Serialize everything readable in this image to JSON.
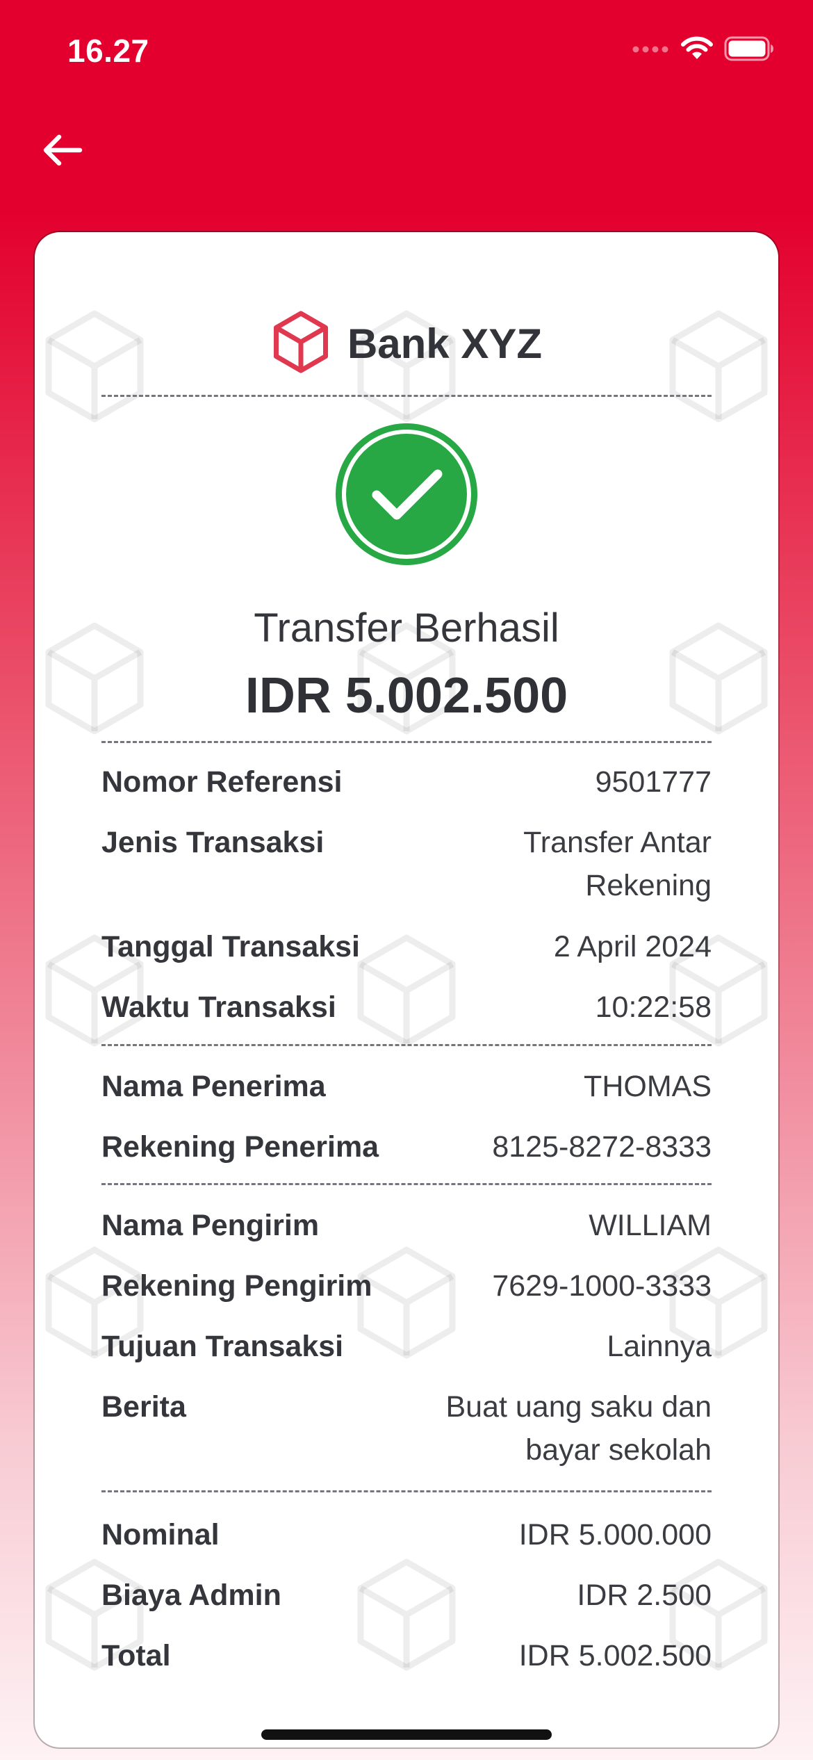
{
  "status_bar": {
    "time": "16.27"
  },
  "colors": {
    "brand_red": "#E3002E",
    "success_green": "#27A844",
    "logo_red": "#E0384F"
  },
  "icons": {
    "back": "arrow-left-icon",
    "logo": "cube-icon",
    "success": "check-circle-icon"
  },
  "receipt": {
    "bank_name": "Bank XYZ",
    "status_title": "Transfer Berhasil",
    "amount": "IDR 5.002.500",
    "transaction": [
      {
        "label": "Nomor Referensi",
        "value": "9501777"
      },
      {
        "label": "Jenis Transaksi",
        "value": "Transfer Antar Rekening"
      },
      {
        "label": "Tanggal Transaksi",
        "value": "2 April 2024"
      },
      {
        "label": "Waktu Transaksi",
        "value": "10:22:58"
      }
    ],
    "receiver": [
      {
        "label": "Nama Penerima",
        "value": "THOMAS"
      },
      {
        "label": "Rekening Penerima",
        "value": "8125-8272-8333"
      }
    ],
    "sender": [
      {
        "label": "Nama Pengirim",
        "value": "WILLIAM"
      },
      {
        "label": "Rekening Pengirim",
        "value": "7629-1000-3333"
      },
      {
        "label": "Tujuan Transaksi",
        "value": "Lainnya"
      },
      {
        "label": "Berita",
        "value": "Buat uang saku dan bayar sekolah"
      }
    ],
    "summary": [
      {
        "label": "Nominal",
        "value": "IDR 5.000.000"
      },
      {
        "label": "Biaya Admin",
        "value": "IDR 2.500"
      },
      {
        "label": "Total",
        "value": "IDR 5.002.500"
      }
    ]
  }
}
